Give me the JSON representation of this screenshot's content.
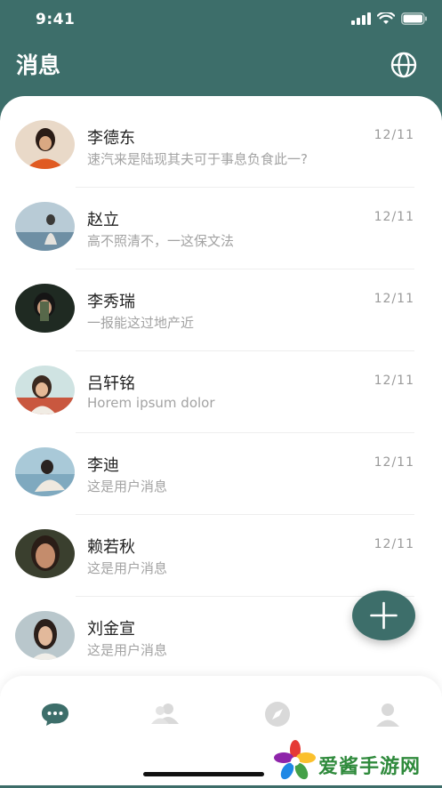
{
  "status_bar": {
    "time": "9:41"
  },
  "header": {
    "title": "消息"
  },
  "chats": [
    {
      "name": "李德东",
      "preview": "速汽来是陆现其夫可于事息负食此一?",
      "date": "12/11"
    },
    {
      "name": "赵立",
      "preview": "高不照清不，一这保文法",
      "date": "12/11"
    },
    {
      "name": "李秀瑞",
      "preview": "一报能这过地产近",
      "date": "12/11"
    },
    {
      "name": "吕轩铭",
      "preview": "Horem ipsum dolor",
      "date": "12/11"
    },
    {
      "name": "李迪",
      "preview": "这是用户消息",
      "date": "12/11"
    },
    {
      "name": "赖若秋",
      "preview": "这是用户消息",
      "date": "12/11"
    },
    {
      "name": "刘金宣",
      "preview": "这是用户消息",
      "date": ""
    }
  ],
  "tabs": [
    {
      "icon": "chat-bubble-icon",
      "active": true
    },
    {
      "icon": "contacts-icon",
      "active": false
    },
    {
      "icon": "compass-icon",
      "active": false
    },
    {
      "icon": "profile-icon",
      "active": false
    }
  ],
  "watermark": {
    "text": "爱酱手游网"
  },
  "colors": {
    "primary": "#3d6e6a",
    "inactive_icon": "#d9d9d9",
    "preview_text": "#a3a3a3"
  }
}
